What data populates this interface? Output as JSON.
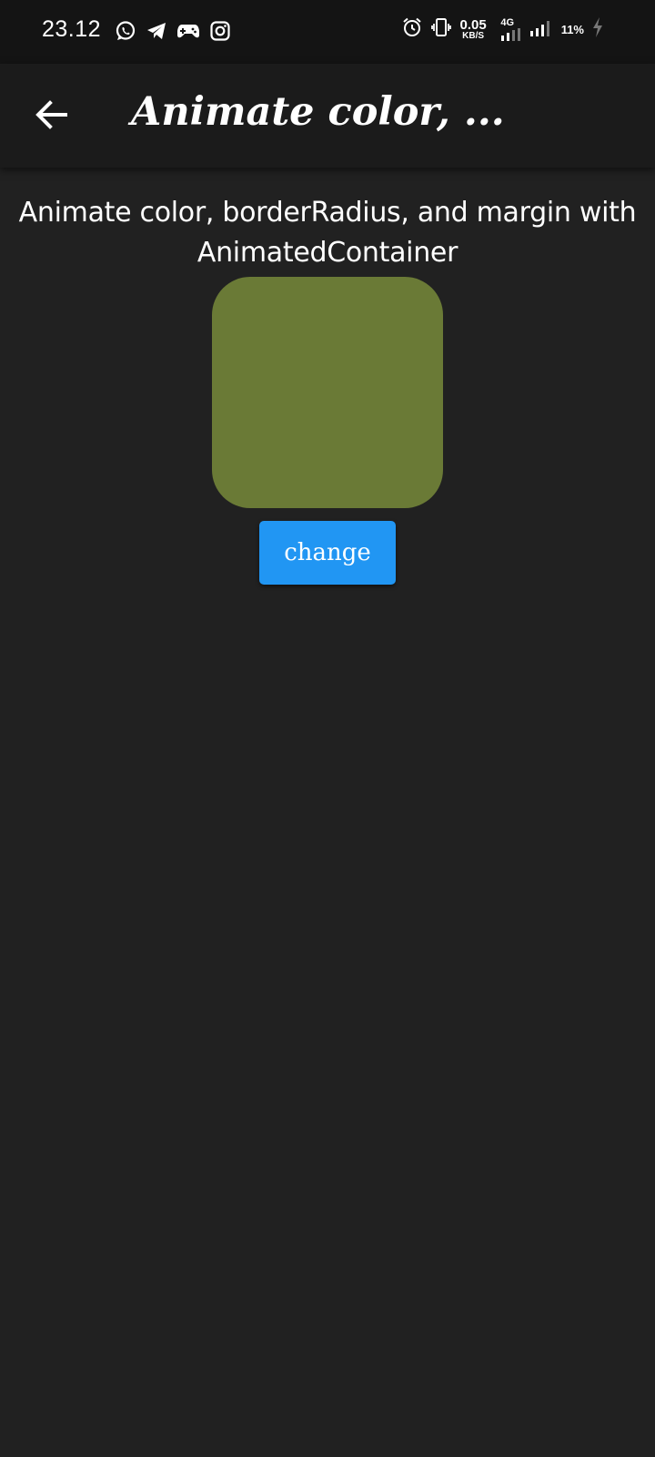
{
  "status_bar": {
    "time": "23.12",
    "left_icons": [
      "whatsapp-icon",
      "telegram-icon",
      "gamepad-icon",
      "instagram-icon"
    ],
    "net_speed_value": "0.05",
    "net_speed_unit": "KB/S",
    "network_type": "4G",
    "battery": "11%"
  },
  "app_bar": {
    "title": "Animate color, ..."
  },
  "main": {
    "description": "Animate color,  borderRadius,  and margin with AnimatedContainer",
    "box_color": "#6a7a36",
    "button_label": "change",
    "button_color": "#2196f3"
  }
}
